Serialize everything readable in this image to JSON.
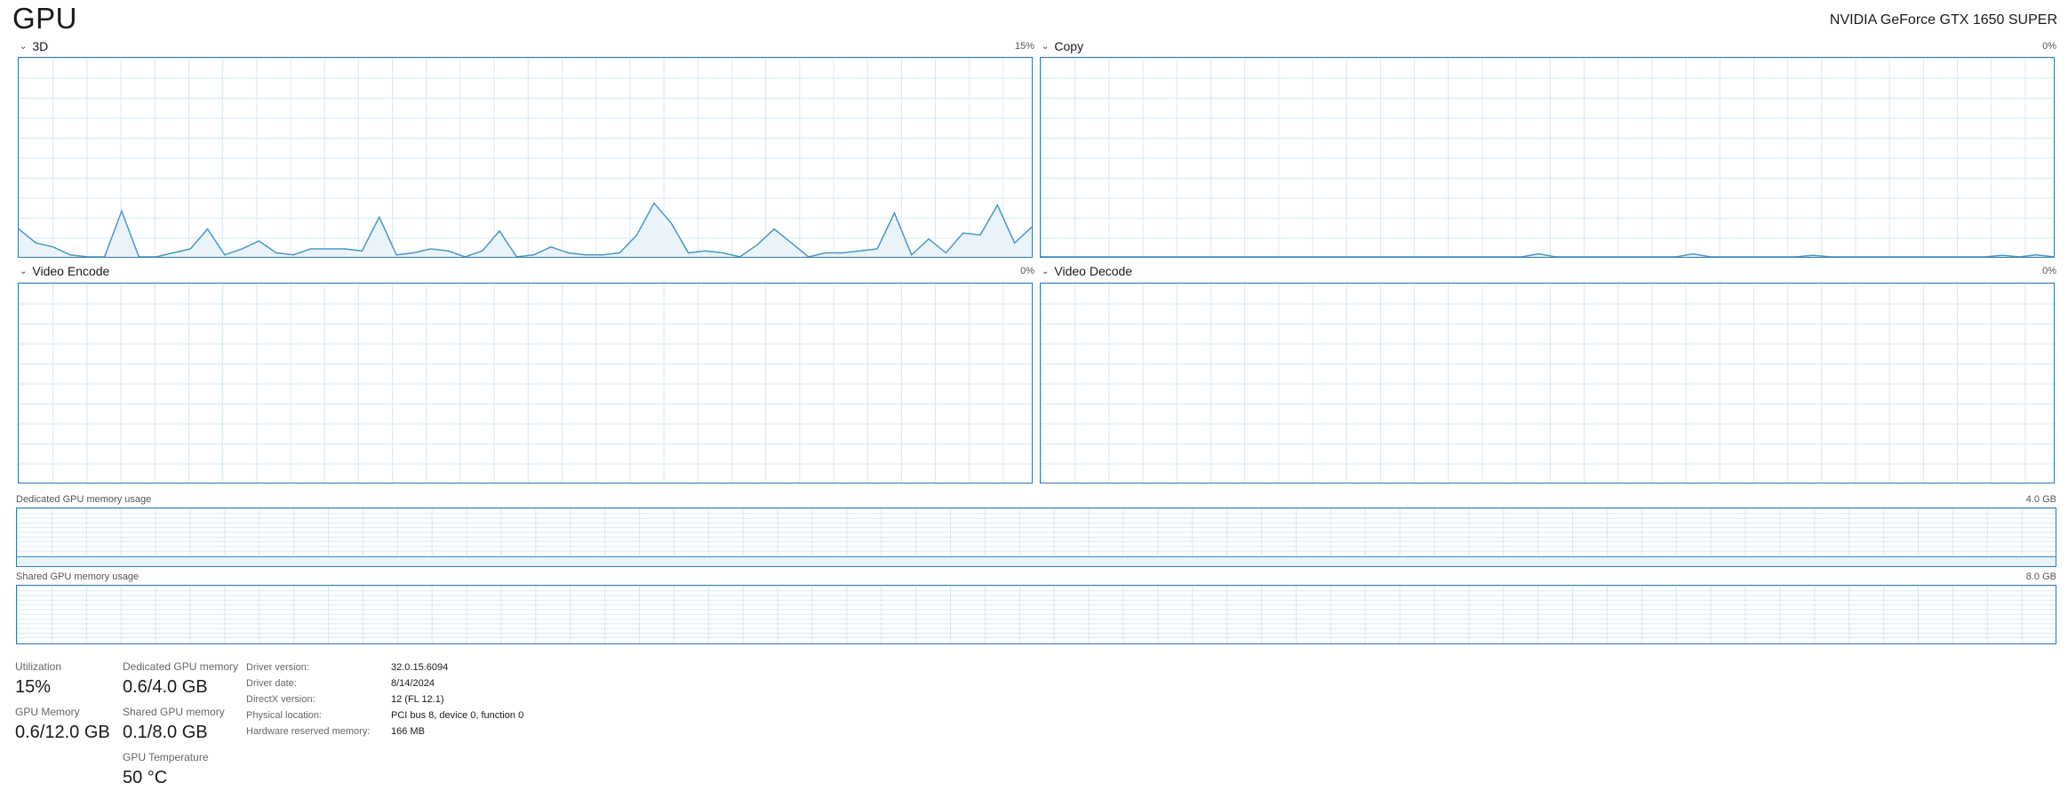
{
  "header": {
    "title": "GPU",
    "gpu_name": "NVIDIA GeForce GTX 1650 SUPER"
  },
  "graphs": [
    {
      "label": "3D",
      "max": "15%",
      "series": [
        14,
        7,
        5,
        1,
        0,
        0,
        23,
        0,
        0,
        2,
        4,
        14,
        1,
        4,
        8,
        2,
        1,
        4,
        4,
        4,
        3,
        20,
        1,
        2,
        4,
        3,
        0,
        3,
        13,
        0,
        1,
        5,
        2,
        1,
        1,
        2,
        11,
        27,
        17,
        2,
        3,
        2,
        0,
        6,
        14,
        7,
        0,
        2,
        2,
        3,
        4,
        22,
        1,
        9,
        2,
        12,
        11,
        26,
        7,
        15
      ]
    },
    {
      "label": "Copy",
      "max": "0%",
      "series": [
        0,
        0,
        0,
        0,
        0,
        0,
        0,
        0,
        0,
        0,
        0,
        0,
        0,
        0,
        0,
        0,
        0,
        0,
        0,
        0,
        0,
        0,
        0,
        0,
        0,
        0,
        0,
        0,
        0,
        1.5,
        0,
        0,
        0,
        0,
        0,
        0,
        0,
        0,
        1.5,
        0,
        0,
        0,
        0,
        0,
        0,
        0.8,
        0,
        0,
        0,
        0,
        0,
        0,
        0,
        0,
        0,
        0,
        0.8,
        0,
        1,
        0
      ]
    },
    {
      "label": "Video Encode",
      "max": "0%",
      "series": []
    },
    {
      "label": "Video Decode",
      "max": "0%",
      "series": []
    }
  ],
  "dedicated_memory": {
    "label": "Dedicated GPU memory usage",
    "max": "4.0 GB",
    "level_fraction": 0.15
  },
  "shared_memory": {
    "label": "Shared GPU memory usage",
    "max": "8.0 GB",
    "level_fraction": 0.0
  },
  "stats": {
    "utilization": {
      "label": "Utilization",
      "value": "15%"
    },
    "gpu_memory": {
      "label": "GPU Memory",
      "value": "0.6/12.0 GB"
    },
    "dedicated": {
      "label": "Dedicated GPU memory",
      "value": "0.6/4.0 GB"
    },
    "shared": {
      "label": "Shared GPU memory",
      "value": "0.1/8.0 GB"
    },
    "temperature": {
      "label": "GPU Temperature",
      "value": "50 °C"
    }
  },
  "info": [
    {
      "label": "Driver version:",
      "value": "32.0.15.6094"
    },
    {
      "label": "Driver date:",
      "value": "8/14/2024"
    },
    {
      "label": "DirectX version:",
      "value": "12 (FL 12.1)"
    },
    {
      "label": "Physical location:",
      "value": "PCI bus 8, device 0, function 0"
    },
    {
      "label": "Hardware reserved memory:",
      "value": "166 MB"
    }
  ],
  "colors": {
    "line": "#4a97c4",
    "fill": "#e9f3f9",
    "border": "#2d7bb0",
    "grid": "#d7e8f3"
  }
}
